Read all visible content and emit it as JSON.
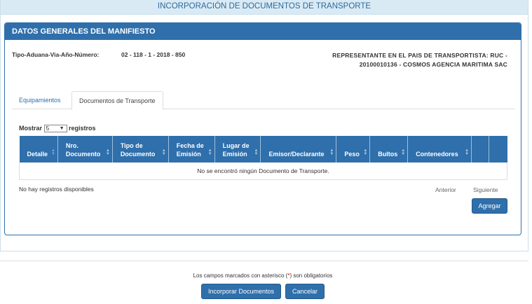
{
  "page": {
    "title": "INCORPORACIÓN DE DOCUMENTOS DE TRANSPORTE"
  },
  "panel": {
    "title": "DATOS GENERALES DEL MANIFIESTO",
    "tipo_label": "Tipo-Aduana-Via-Año-Número:",
    "tipo_value": "02 - 118 - 1 - 2018 - 850",
    "representante": "REPRESENTANTE EN EL PAIS DE TRANSPORTISTA: RUC - 20100010136 - COSMOS AGENCIA MARITIMA SAC"
  },
  "tabs": [
    {
      "label": "Equipamientos",
      "active": false
    },
    {
      "label": "Documentos de Transporte",
      "active": true
    }
  ],
  "length_menu": {
    "prefix": "Mostrar",
    "value": "5",
    "suffix": "registros"
  },
  "table": {
    "columns": [
      "Detalle",
      "Nro. Documento",
      "Tipo de Documento",
      "Fecha de Emisión",
      "Lugar de Emisión",
      "Emisor/Declarante",
      "Peso",
      "Bultos",
      "Contenedores",
      "",
      ""
    ],
    "empty_message": "No se encontró ningún Documento de Transporte."
  },
  "info": "No hay registros disponibles",
  "pagination": {
    "previous": "Anterior",
    "next": "Siguiente"
  },
  "buttons": {
    "add": "Agregar",
    "incorporate": "Incorporar Documentos",
    "cancel": "Cancelar"
  },
  "footer": {
    "note_before": "Los campos marcados con asterisco (",
    "asterisk": "*",
    "note_after": ") son obligatorios"
  },
  "colors": {
    "primary": "#2f6fab",
    "topbar": "#daeaf4",
    "required": "#cc0000"
  }
}
